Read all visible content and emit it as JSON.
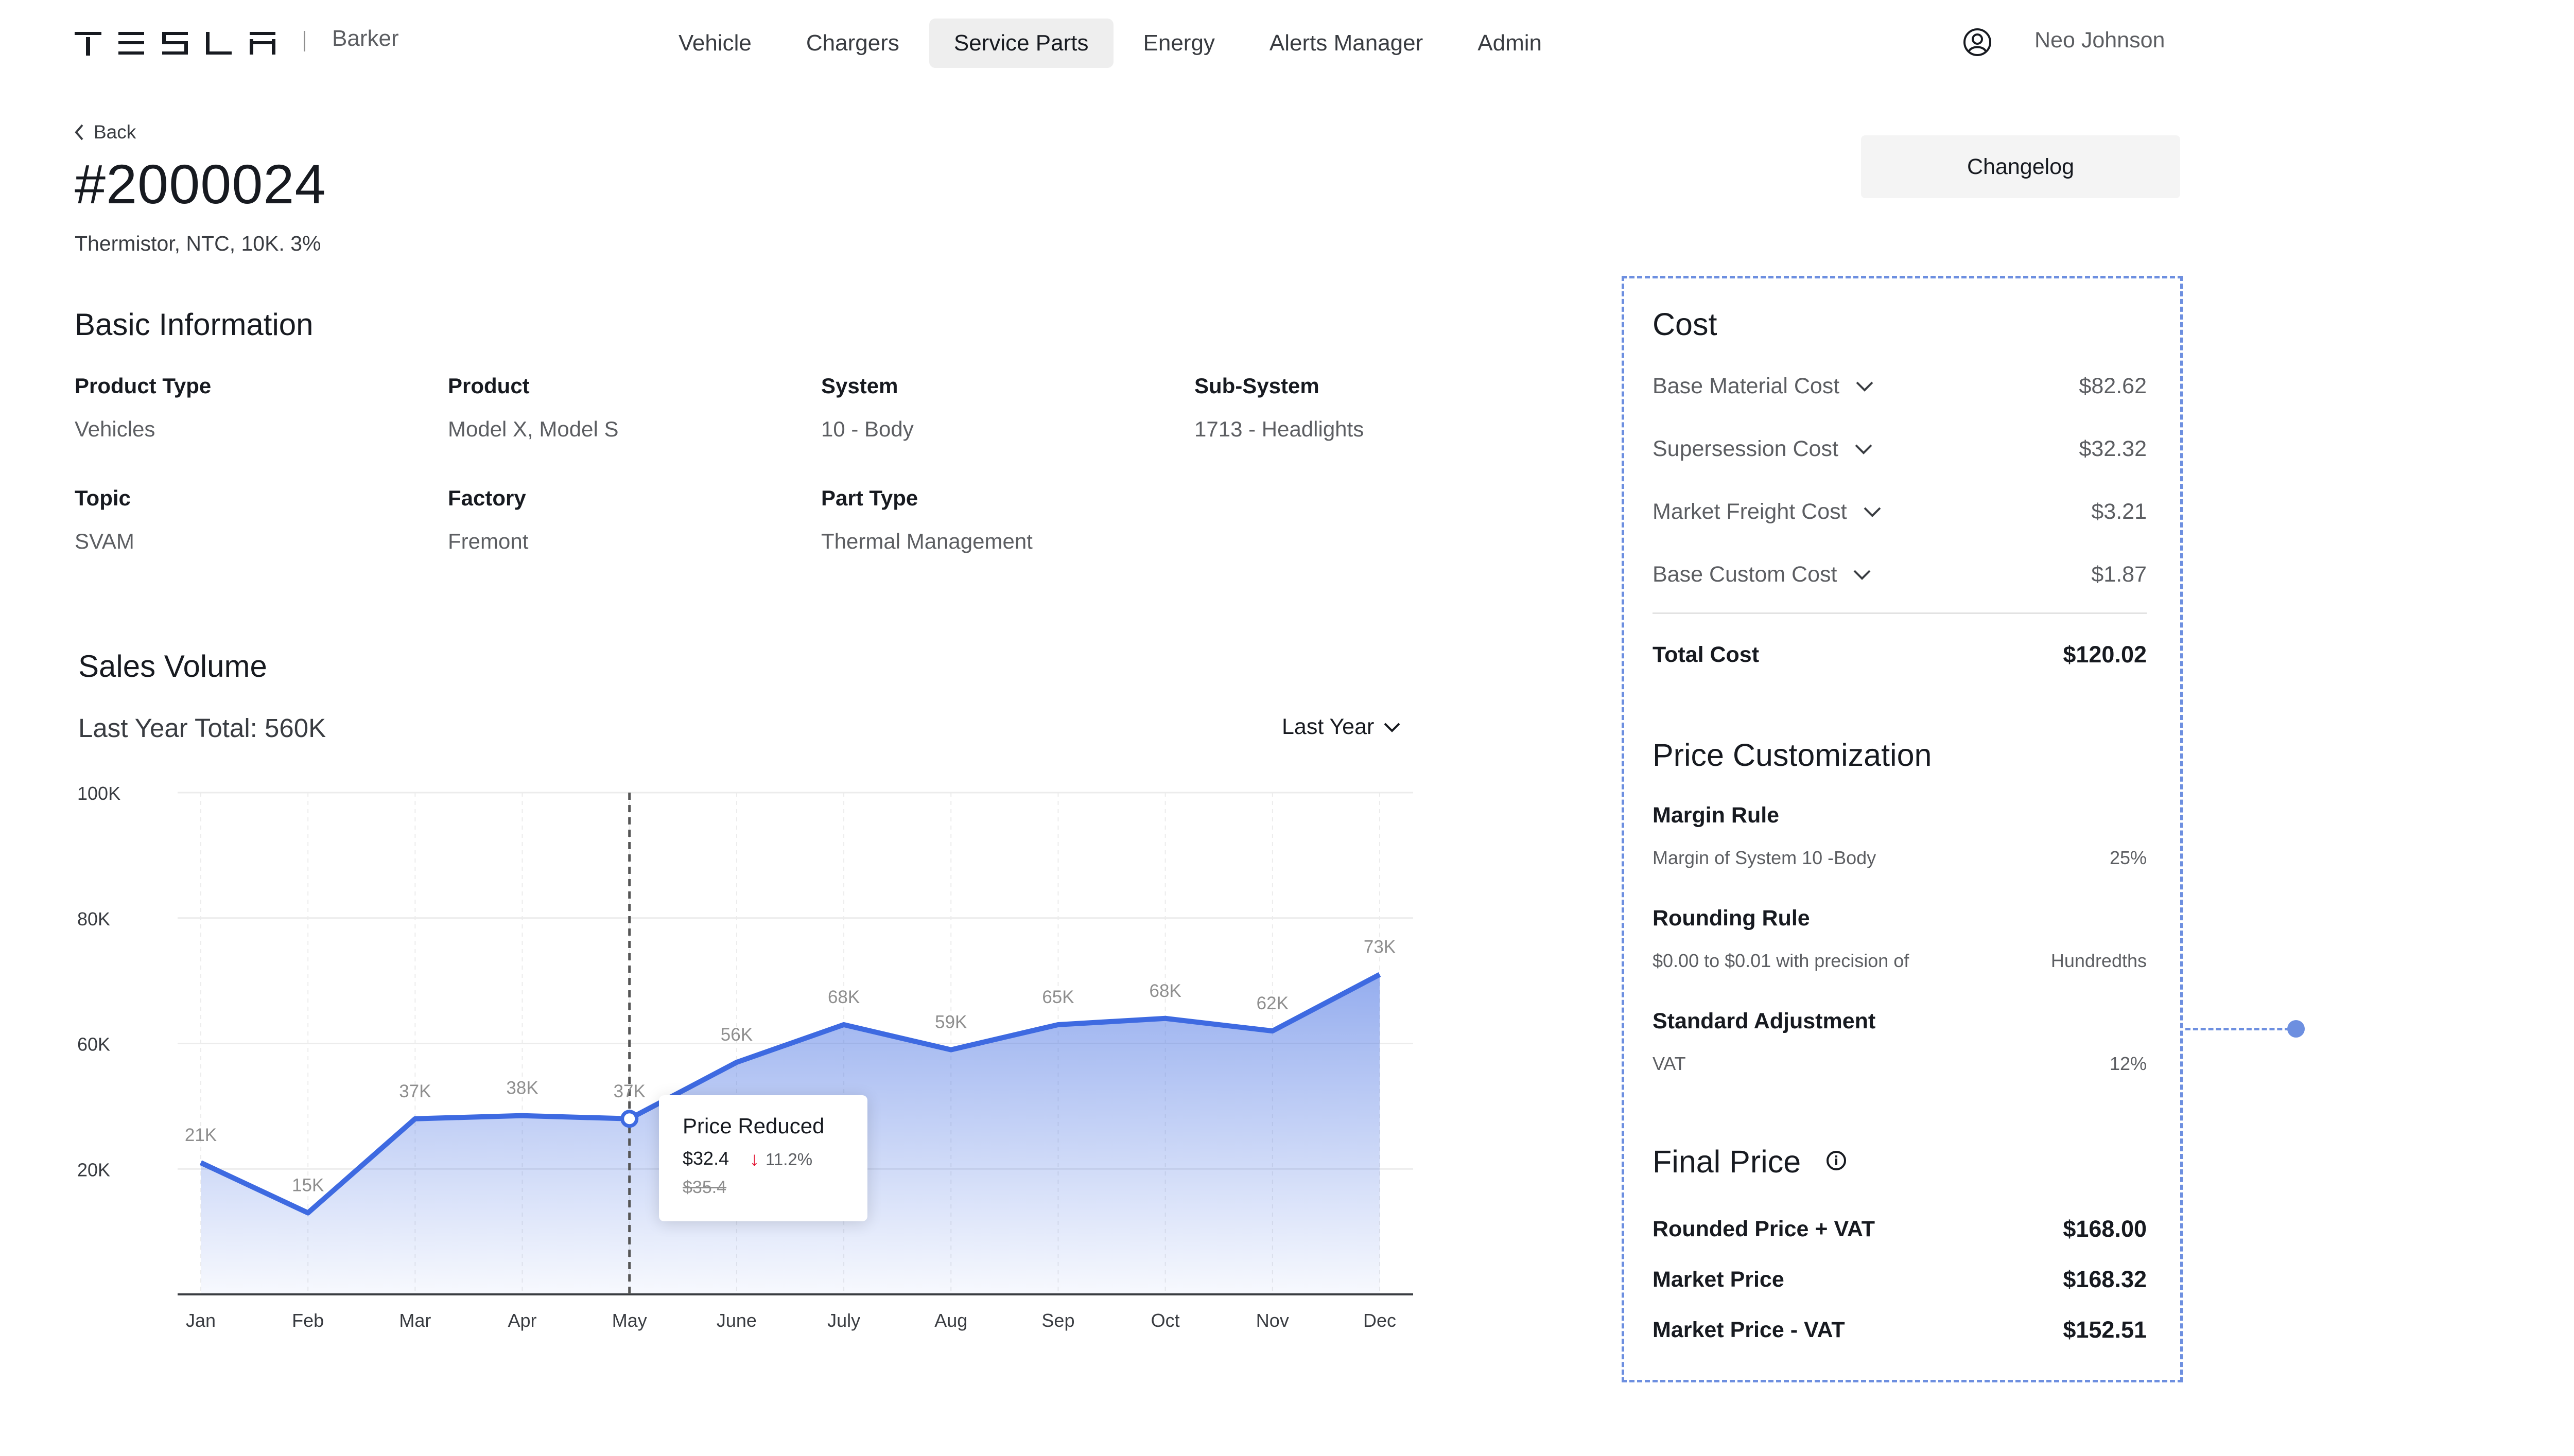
{
  "header": {
    "brand": "TESLA",
    "app_name": "Barker",
    "nav": [
      "Vehicle",
      "Chargers",
      "Service Parts",
      "Energy",
      "Alerts Manager",
      "Admin"
    ],
    "active_nav": "Service Parts",
    "user_name": "Neo Johnson"
  },
  "page": {
    "back_label": "Back",
    "part_number": "#2000024",
    "part_description": "Thermistor, NTC, 10K. 3%",
    "changelog_label": "Changelog"
  },
  "basic_info": {
    "title": "Basic Information",
    "fields": [
      {
        "label": "Product Type",
        "value": "Vehicles"
      },
      {
        "label": "Product",
        "value": "Model X, Model S"
      },
      {
        "label": "System",
        "value": "10 - Body"
      },
      {
        "label": "Sub-System",
        "value": "1713 - Headlights"
      },
      {
        "label": "Topic",
        "value": "SVAM"
      },
      {
        "label": "Factory",
        "value": "Fremont"
      },
      {
        "label": "Part Type",
        "value": "Thermal Management"
      }
    ]
  },
  "sales": {
    "title": "Sales Volume",
    "total": "Last Year Total: 560K",
    "period": "Last Year",
    "tooltip": {
      "title": "Price Reduced",
      "new_price": "$32.4",
      "change": "11.2%",
      "old_price": "$35.4"
    }
  },
  "chart_data": {
    "type": "area",
    "categories": [
      "Jan",
      "Feb",
      "Mar",
      "Apr",
      "May",
      "June",
      "July",
      "Aug",
      "Sep",
      "Oct",
      "Nov",
      "Dec"
    ],
    "values": [
      21,
      13,
      28,
      28.5,
      28,
      37,
      43,
      39,
      43,
      44,
      42,
      51
    ],
    "data_labels": [
      "21K",
      "15K",
      "37K",
      "38K",
      "37K",
      "56K",
      "68K",
      "59K",
      "65K",
      "68K",
      "62K",
      "73K"
    ],
    "y_ticks": [
      20,
      40,
      60,
      80
    ],
    "y_tick_labels": [
      "20K",
      "60K",
      "80K",
      "100K"
    ],
    "ylim": [
      0,
      80
    ],
    "marker_category": "May",
    "grid": true,
    "color": "#3e6ae1"
  },
  "cost": {
    "title": "Cost",
    "items": [
      {
        "label": "Base Material Cost",
        "amount": "$82.62"
      },
      {
        "label": "Supersession Cost",
        "amount": "$32.32"
      },
      {
        "label": "Market Freight Cost",
        "amount": "$3.21"
      },
      {
        "label": "Base Custom Cost",
        "amount": "$1.87"
      }
    ],
    "total_label": "Total Cost",
    "total_amount": "$120.02"
  },
  "price_customization": {
    "title": "Price Customization",
    "rules": [
      {
        "title": "Margin Rule",
        "desc": "Margin of System 10 -Body",
        "value": "25%"
      },
      {
        "title": "Rounding Rule",
        "desc": "$0.00 to $0.01 with precision of",
        "value": "Hundredths"
      },
      {
        "title": "Standard Adjustment",
        "desc": "VAT",
        "value": "12%"
      }
    ]
  },
  "final_price": {
    "title": "Final Price",
    "items": [
      {
        "label": "Rounded Price + VAT",
        "amount": "$168.00"
      },
      {
        "label": "Market Price",
        "amount": "$168.32"
      },
      {
        "label": "Market Price - VAT",
        "amount": "$152.51"
      }
    ]
  },
  "colors": {
    "accent": "#3e6ae1",
    "dashed_outline": "#6d8fe0",
    "down_arrow": "#e31937"
  },
  "icons": [
    "tesla-logo",
    "user-circle-icon",
    "chevron-left-icon",
    "chevron-down-icon",
    "info-icon",
    "arrow-down-icon"
  ]
}
